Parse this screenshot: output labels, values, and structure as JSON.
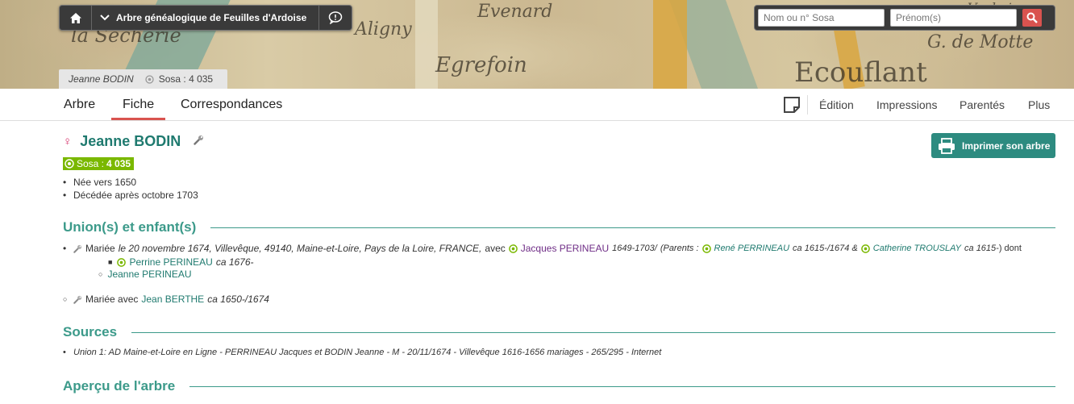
{
  "header": {
    "site_title": "Arbre généalogique de Feuilles d'Ardoise",
    "search_name_placeholder": "Nom ou n° Sosa",
    "search_firstname_placeholder": "Prénom(s)"
  },
  "banner_words": [
    "la Sécherie",
    "Evenard",
    "Aligny",
    "Egrefoin",
    "G. de Motte",
    "Ecouflant",
    "Vaubois"
  ],
  "person_tab": {
    "name": "Jeanne BODIN",
    "sosa": "Sosa : 4 035"
  },
  "tabs": [
    {
      "label": "Arbre",
      "active": false
    },
    {
      "label": "Fiche",
      "active": true
    },
    {
      "label": "Correspondances",
      "active": false
    }
  ],
  "right_menu": [
    "Édition",
    "Impressions",
    "Parentés",
    "Plus"
  ],
  "person": {
    "name": "Jeanne BODIN",
    "sosa_label": "Sosa :",
    "sosa_number": "4 035",
    "facts": [
      "Née vers 1650",
      "Décédée après octobre 1703"
    ]
  },
  "print_button": "Imprimer son arbre",
  "sections": {
    "unions": "Union(s) et enfant(s)",
    "sources": "Sources",
    "tree": "Aperçu de l'arbre"
  },
  "union1": {
    "married": "Mariée",
    "details": "le 20 novembre 1674, Villevêque, 49140, Maine-et-Loire, Pays de la Loire, FRANCE,",
    "avec": "avec",
    "spouse": "Jacques PERINEAU",
    "spouse_dates": "1649-1703/",
    "parents_open": "(Parents :",
    "father": "René PERRINEAU",
    "father_dates": "ca 1615-/1674 &",
    "mother": "Catherine TROUSLAY",
    "mother_dates": "ca 1615-",
    "parents_close": ") dont",
    "children": [
      {
        "name": "Perrine PERINEAU",
        "dates": "ca 1676-"
      },
      {
        "name": "Jeanne PERINEAU",
        "dates": ""
      }
    ]
  },
  "union2": {
    "married": "Mariée avec",
    "spouse": "Jean BERTHE",
    "dates": "ca 1650-/1674"
  },
  "source1": "Union 1: AD Maine-et-Loire en Ligne - PERRINEAU Jacques et BODIN Jeanne - M - 20/11/1674 - Villevêque 1616-1656 mariages - 265/295 - Internet",
  "colors": {
    "accent": "#1f7a6f",
    "section": "#3c9a8a",
    "sosa_green": "#7ab800",
    "active_tab": "#d9534f",
    "spouse_link": "#6f2d86"
  }
}
